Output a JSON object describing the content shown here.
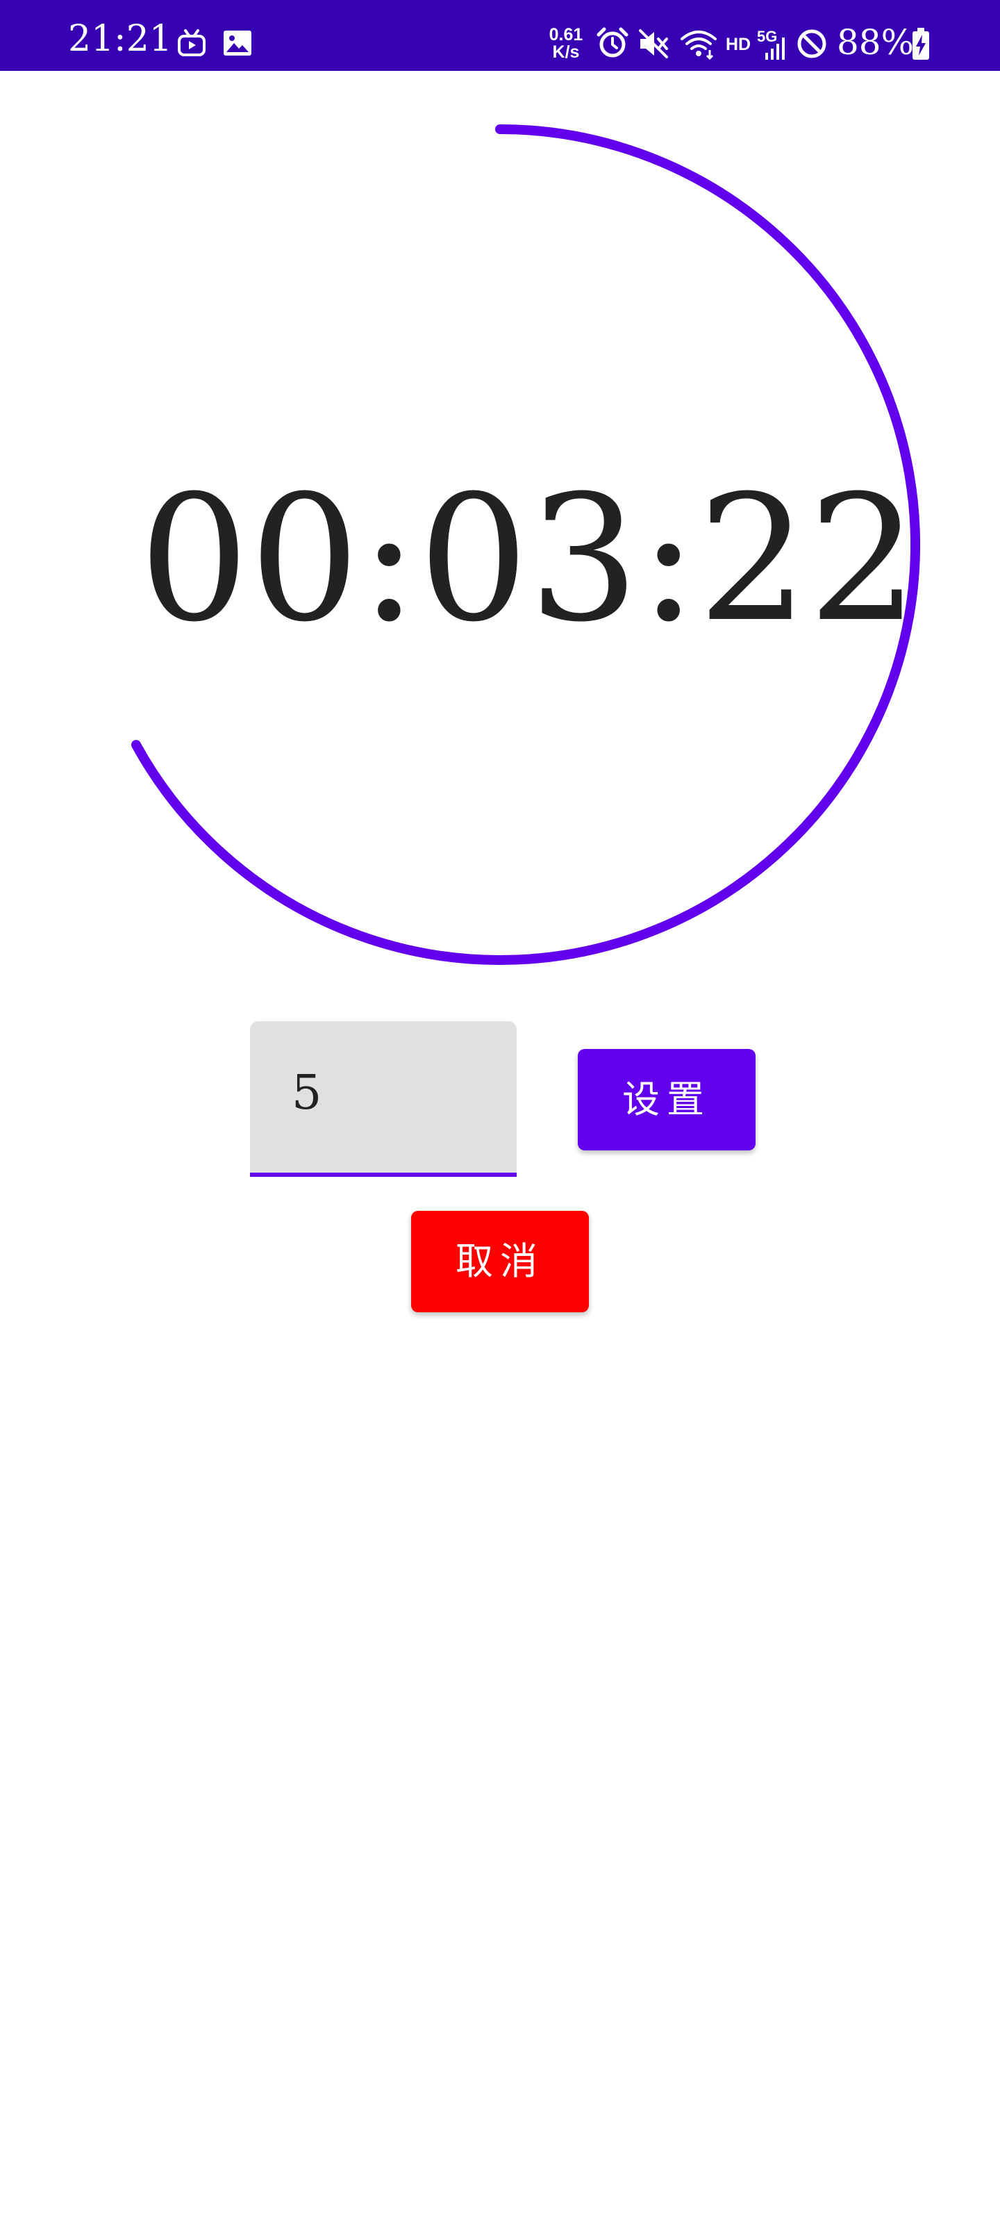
{
  "status_bar": {
    "time": "21:21",
    "net_speed_value": "0.61",
    "net_speed_unit": "K/s",
    "hd": "HD",
    "network": "5G",
    "battery": "88%",
    "icons": [
      "tv-app-icon",
      "gallery-icon",
      "alarm-icon",
      "mute-icon",
      "wifi-icon",
      "signal-icon",
      "do-not-disturb-icon",
      "battery-charging-icon"
    ],
    "background_color": "#3700b3"
  },
  "timer": {
    "display": "00:03:22",
    "progress_color": "#6200ee",
    "progress_fraction": 0.67
  },
  "input": {
    "value": "5",
    "underline_color": "#6200ee"
  },
  "buttons": {
    "set_label": "设置",
    "set_color": "#6200ee",
    "cancel_label": "取消",
    "cancel_color": "#ff0000"
  }
}
